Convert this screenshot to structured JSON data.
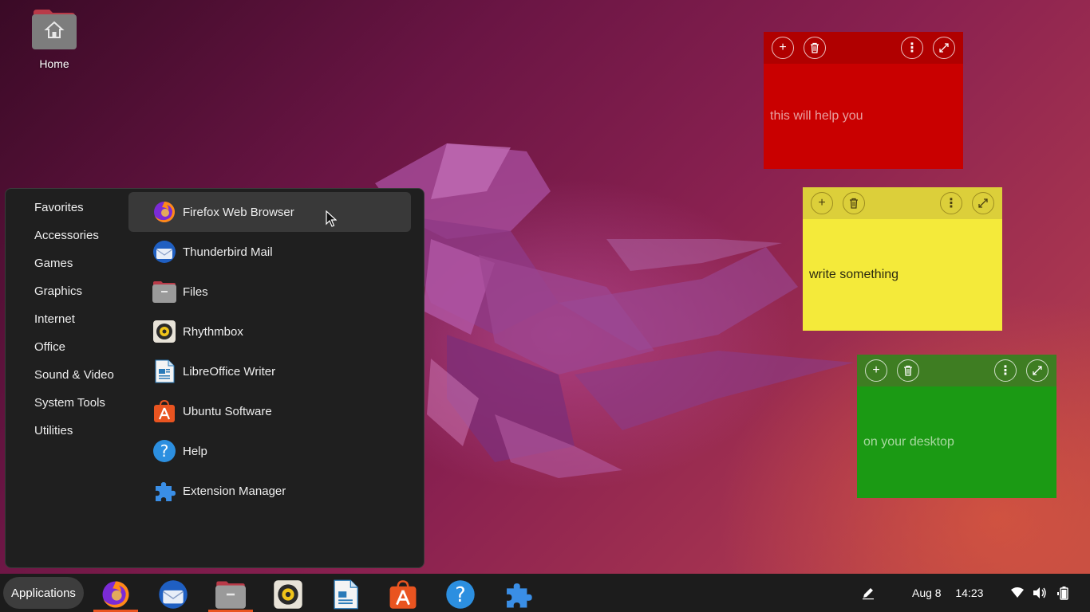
{
  "desktop": {
    "home_label": "Home"
  },
  "notes": [
    {
      "text": "this will help you",
      "color": "#c90000"
    },
    {
      "text": "write something",
      "color": "#f4ea3a"
    },
    {
      "text": "on your desktop",
      "color": "#1b9a14"
    }
  ],
  "menu": {
    "categories": [
      "Favorites",
      "Accessories",
      "Games",
      "Graphics",
      "Internet",
      "Office",
      "Sound & Video",
      "System Tools",
      "Utilities"
    ],
    "apps": [
      {
        "label": "Firefox Web Browser",
        "icon": "firefox-icon"
      },
      {
        "label": "Thunderbird Mail",
        "icon": "thunderbird-icon"
      },
      {
        "label": "Files",
        "icon": "files-icon"
      },
      {
        "label": "Rhythmbox",
        "icon": "rhythmbox-icon"
      },
      {
        "label": "LibreOffice Writer",
        "icon": "writer-icon"
      },
      {
        "label": "Ubuntu Software",
        "icon": "ubuntu-software-icon"
      },
      {
        "label": "Help",
        "icon": "help-icon"
      },
      {
        "label": "Extension Manager",
        "icon": "extension-manager-icon"
      }
    ],
    "active_index": 0
  },
  "taskbar": {
    "applications_label": "Applications",
    "date": "Aug 8",
    "time": "14:23",
    "accent": "#e95420"
  }
}
